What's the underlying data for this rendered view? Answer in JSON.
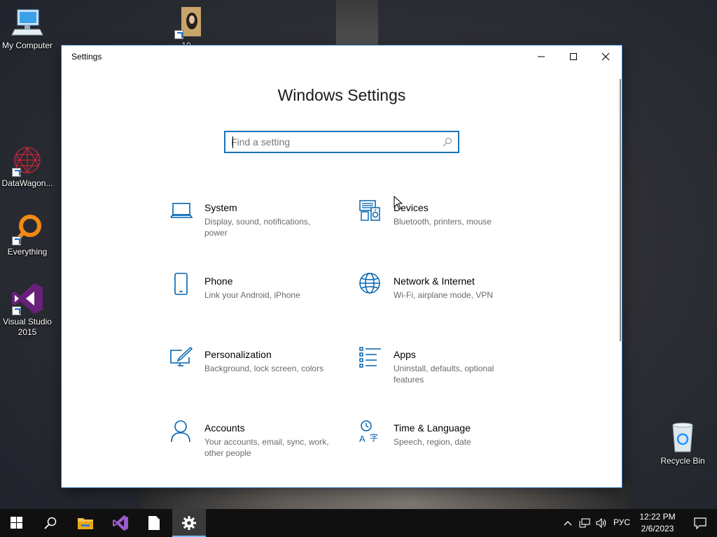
{
  "desktop": {
    "icons": [
      {
        "label": "My Computer"
      },
      {
        "label": "10..."
      },
      {
        "label": "DataWagon..."
      },
      {
        "label": "Everything"
      },
      {
        "label": "Visual Studio 2015"
      },
      {
        "label": "Recycle Bin"
      }
    ]
  },
  "window": {
    "title": "Settings",
    "heading": "Windows Settings",
    "search": {
      "placeholder": "Find a setting",
      "value": ""
    },
    "controls": {
      "minimize": "minimize-icon",
      "maximize": "maximize-icon",
      "close": "close-icon"
    },
    "categories": [
      {
        "name": "System",
        "description": "Display, sound, notifications, power",
        "icon": "laptop-icon"
      },
      {
        "name": "Devices",
        "description": "Bluetooth, printers, mouse",
        "icon": "keyboard-speaker-icon"
      },
      {
        "name": "Phone",
        "description": "Link your Android, iPhone",
        "icon": "phone-icon"
      },
      {
        "name": "Network & Internet",
        "description": "Wi-Fi, airplane mode, VPN",
        "icon": "globe-icon"
      },
      {
        "name": "Personalization",
        "description": "Background, lock screen, colors",
        "icon": "paint-monitor-icon"
      },
      {
        "name": "Apps",
        "description": "Uninstall, defaults, optional features",
        "icon": "apps-list-icon"
      },
      {
        "name": "Accounts",
        "description": "Your accounts, email, sync, work, other people",
        "icon": "person-icon"
      },
      {
        "name": "Time & Language",
        "description": "Speech, region, date",
        "icon": "time-language-icon"
      }
    ]
  },
  "taskbar": {
    "pinned": [
      "start-icon",
      "search-icon",
      "file-explorer-icon",
      "visual-studio-icon",
      "document-icon",
      "settings-icon"
    ],
    "active": "settings-icon",
    "tray": {
      "language": "РУС",
      "time": "12:22 PM",
      "date": "2/6/2023"
    }
  },
  "colors": {
    "accent": "#1a73b8",
    "icon_blue": "#0063b1",
    "taskbar": "#101010"
  }
}
